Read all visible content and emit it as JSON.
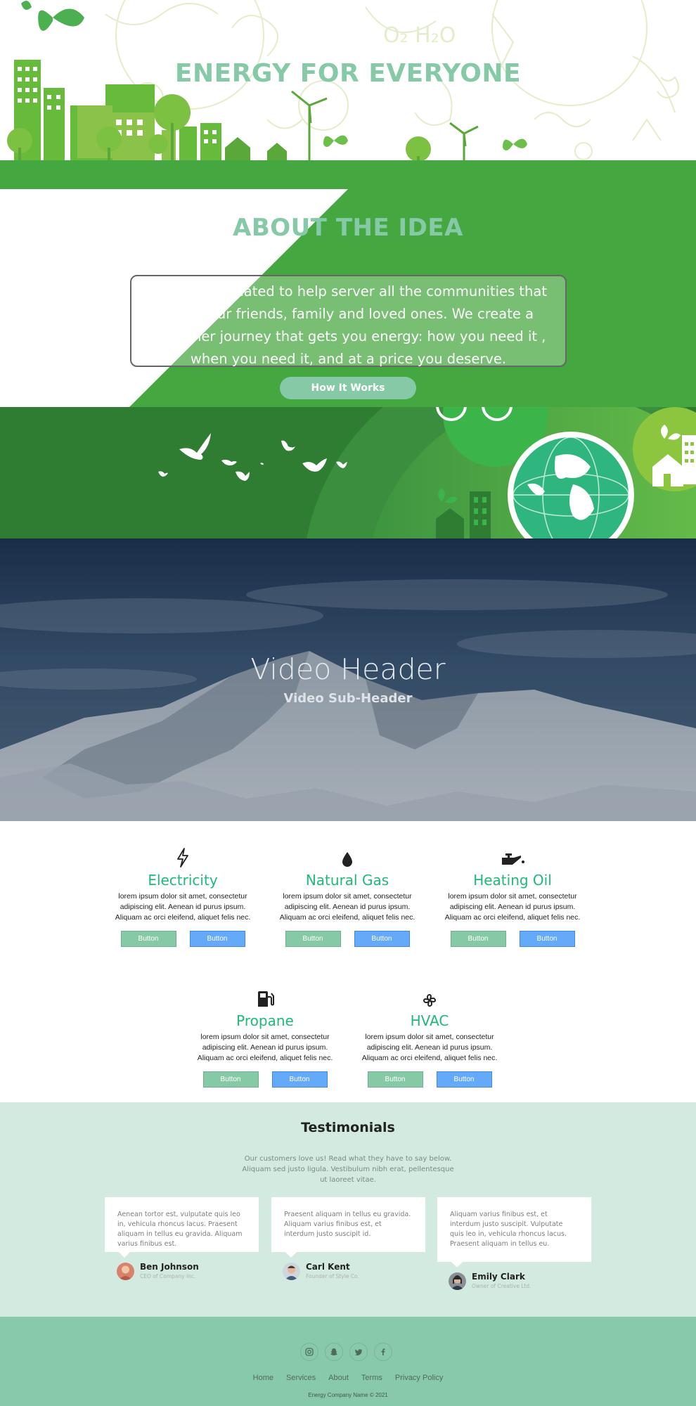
{
  "hero": {
    "title": "ENERGY FOR EVERYONE"
  },
  "about": {
    "title": "ABOUT THE IDEA",
    "text": "A concept created to help server all the communities that house our friends, family and loved ones. We create a customer journey that gets you energy: how you need it , when you need it, and at a price you deserve.",
    "button_label": "How It Works"
  },
  "video": {
    "title": "Video Header",
    "subtitle": "Video Sub-Header"
  },
  "services": [
    {
      "icon": "lightning-icon",
      "title": "Electricity",
      "desc": "lorem ipsum dolor sit amet, consectetur adipiscing elit. Aenean id purus ipsum. Aliquam ac orci eleifend, aliquet felis nec.",
      "btn1": "Button",
      "btn2": "Button"
    },
    {
      "icon": "droplet-icon",
      "title": "Natural Gas",
      "desc": "lorem ipsum dolor sit amet, consectetur adipiscing elit. Aenean id purus ipsum. Aliquam ac orci eleifend, aliquet felis nec.",
      "btn1": "Button",
      "btn2": "Button"
    },
    {
      "icon": "oil-can-icon",
      "title": "Heating Oil",
      "desc": "lorem ipsum dolor sit amet, consectetur adipiscing elit. Aenean id purus ipsum. Aliquam ac orci eleifend, aliquet felis nec.",
      "btn1": "Button",
      "btn2": "Button"
    },
    {
      "icon": "gas-pump-icon",
      "title": "Propane",
      "desc": "lorem ipsum dolor sit amet, consectetur adipiscing elit. Aenean id purus ipsum. Aliquam ac orci eleifend, aliquet felis nec.",
      "btn1": "Button",
      "btn2": "Button"
    },
    {
      "icon": "fan-icon",
      "title": "HVAC",
      "desc": "lorem ipsum dolor sit amet, consectetur adipiscing elit. Aenean id purus ipsum. Aliquam ac orci eleifend, aliquet felis nec.",
      "btn1": "Button",
      "btn2": "Button"
    }
  ],
  "testimonials": {
    "title": "Testimonials",
    "intro": "Our customers love us! Read what they have to say below. Aliquam sed justo ligula. Vestibulum nibh erat, pellentesque ut laoreet vitae.",
    "items": [
      {
        "text": "Aenean tortor est, vulputate quis leo in, vehicula rhoncus lacus. Praesent aliquam in tellus eu gravida. Aliquam varius finibus est.",
        "name": "Ben Johnson",
        "role": "CEO of Company Inc."
      },
      {
        "text": "Praesent aliquam in tellus eu gravida. Aliquam varius finibus est, et interdum justo suscipit id.",
        "name": "Carl Kent",
        "role": "Founder of Style Co."
      },
      {
        "text": "Aliquam varius finibus est, et interdum justo suscipit. Vulputate quis leo in, vehicula rhoncus lacus. Praesent aliquam in tellus eu.",
        "name": "Emily Clark",
        "role": "Owner of Creative Ltd."
      }
    ]
  },
  "footer": {
    "socials": [
      "instagram-icon",
      "snapchat-icon",
      "twitter-icon",
      "facebook-icon"
    ],
    "nav": [
      "Home",
      "Services",
      "About",
      "Terms",
      "Privacy Policy"
    ],
    "copyright": "Energy Company Name © 2021"
  },
  "colors": {
    "brand_green": "#45a73f",
    "mint": "#86c9a6",
    "service_title": "#1fb978",
    "button_blue": "#64aaf8",
    "testimonial_bg": "#d2eadf",
    "footer_bg": "#88c9aa"
  }
}
